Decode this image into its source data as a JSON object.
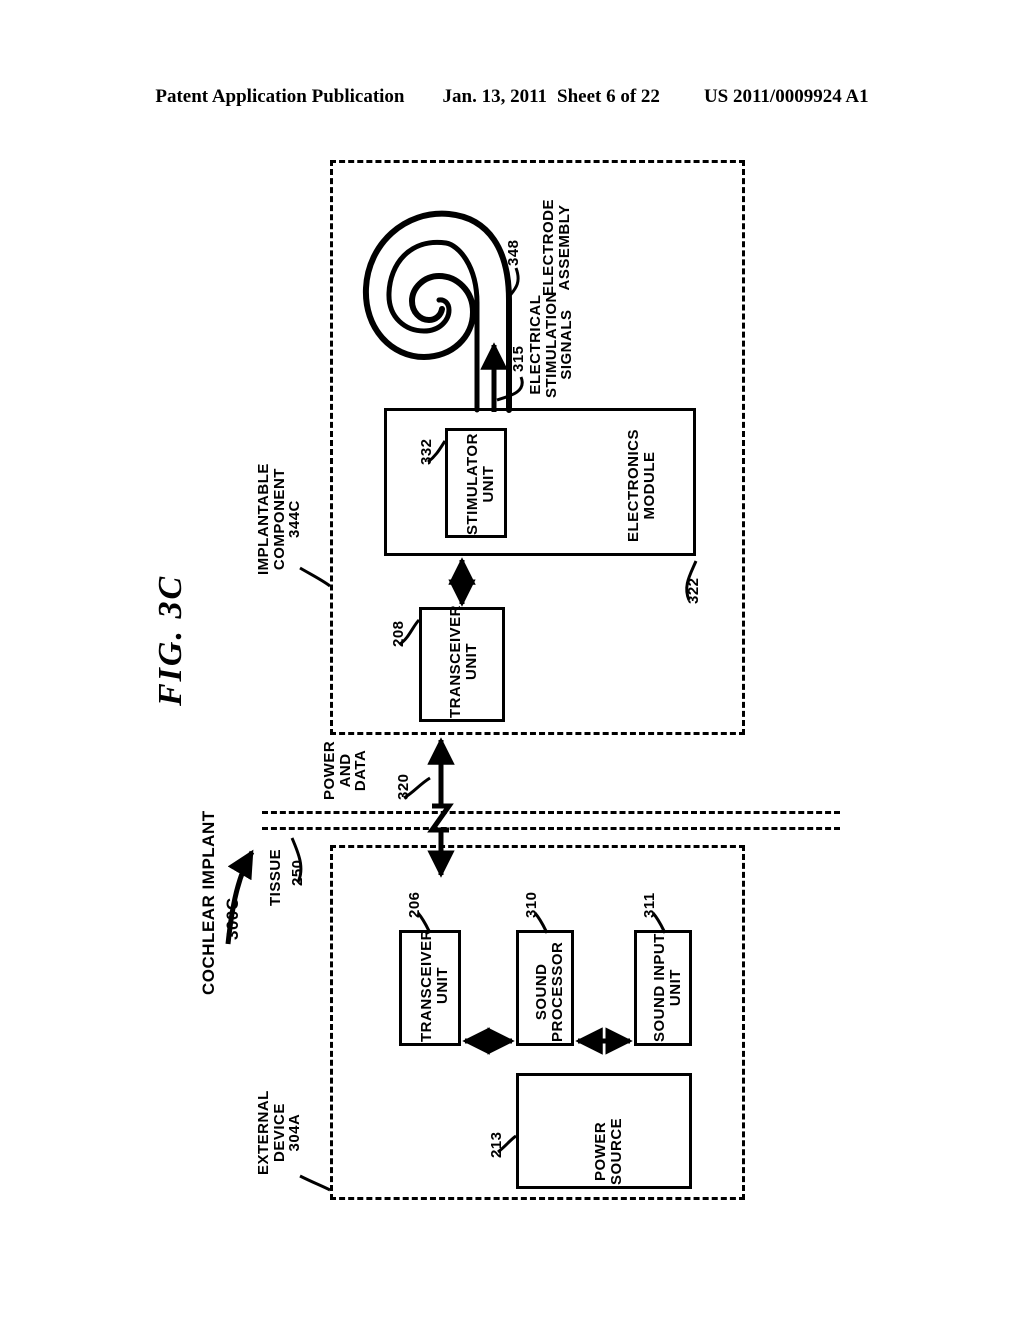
{
  "header": {
    "publication": "Patent Application Publication",
    "date": "Jan. 13, 2011",
    "sheet": "Sheet 6 of 22",
    "number": "US 2011/0009924 A1"
  },
  "figure": {
    "title": "FIG. 3C",
    "system_label": "COCHLEAR IMPLANT",
    "system_ref": "300C"
  },
  "implantable": {
    "label_line1": "IMPLANTABLE",
    "label_line2": "COMPONENT",
    "ref": "344C",
    "electrode": {
      "ref": "348",
      "label_line1": "ELECTRODE",
      "label_line2": "ASSEMBLY"
    },
    "stimulation": {
      "ref": "315",
      "label_line1": "ELECTRICAL",
      "label_line2": "STIMULATION",
      "label_line3": "SIGNALS"
    },
    "electronics_module": {
      "ref": "322",
      "label_line1": "ELECTRONICS",
      "label_line2": "MODULE"
    },
    "stimulator_unit": {
      "ref": "332",
      "label_line1": "STIMULATOR",
      "label_line2": "UNIT"
    },
    "transceiver_unit": {
      "ref": "208",
      "label_line1": "TRANSCEIVER",
      "label_line2": "UNIT"
    }
  },
  "link": {
    "label_line1": "POWER",
    "label_line2": "AND",
    "label_line3": "DATA",
    "ref": "320"
  },
  "tissue": {
    "label": "TISSUE",
    "ref": "250"
  },
  "external": {
    "label_line1": "EXTERNAL",
    "label_line2": "DEVICE",
    "ref": "304A",
    "transceiver_unit": {
      "ref": "206",
      "label_line1": "TRANSCEIVER",
      "label_line2": "UNIT"
    },
    "sound_processor": {
      "ref": "310",
      "label_line1": "SOUND",
      "label_line2": "PROCESSOR"
    },
    "sound_input_unit": {
      "ref": "311",
      "label_line1": "SOUND INPUT",
      "label_line2": "UNIT"
    },
    "power_source": {
      "ref": "213",
      "label_line1": "POWER",
      "label_line2": "SOURCE"
    }
  }
}
